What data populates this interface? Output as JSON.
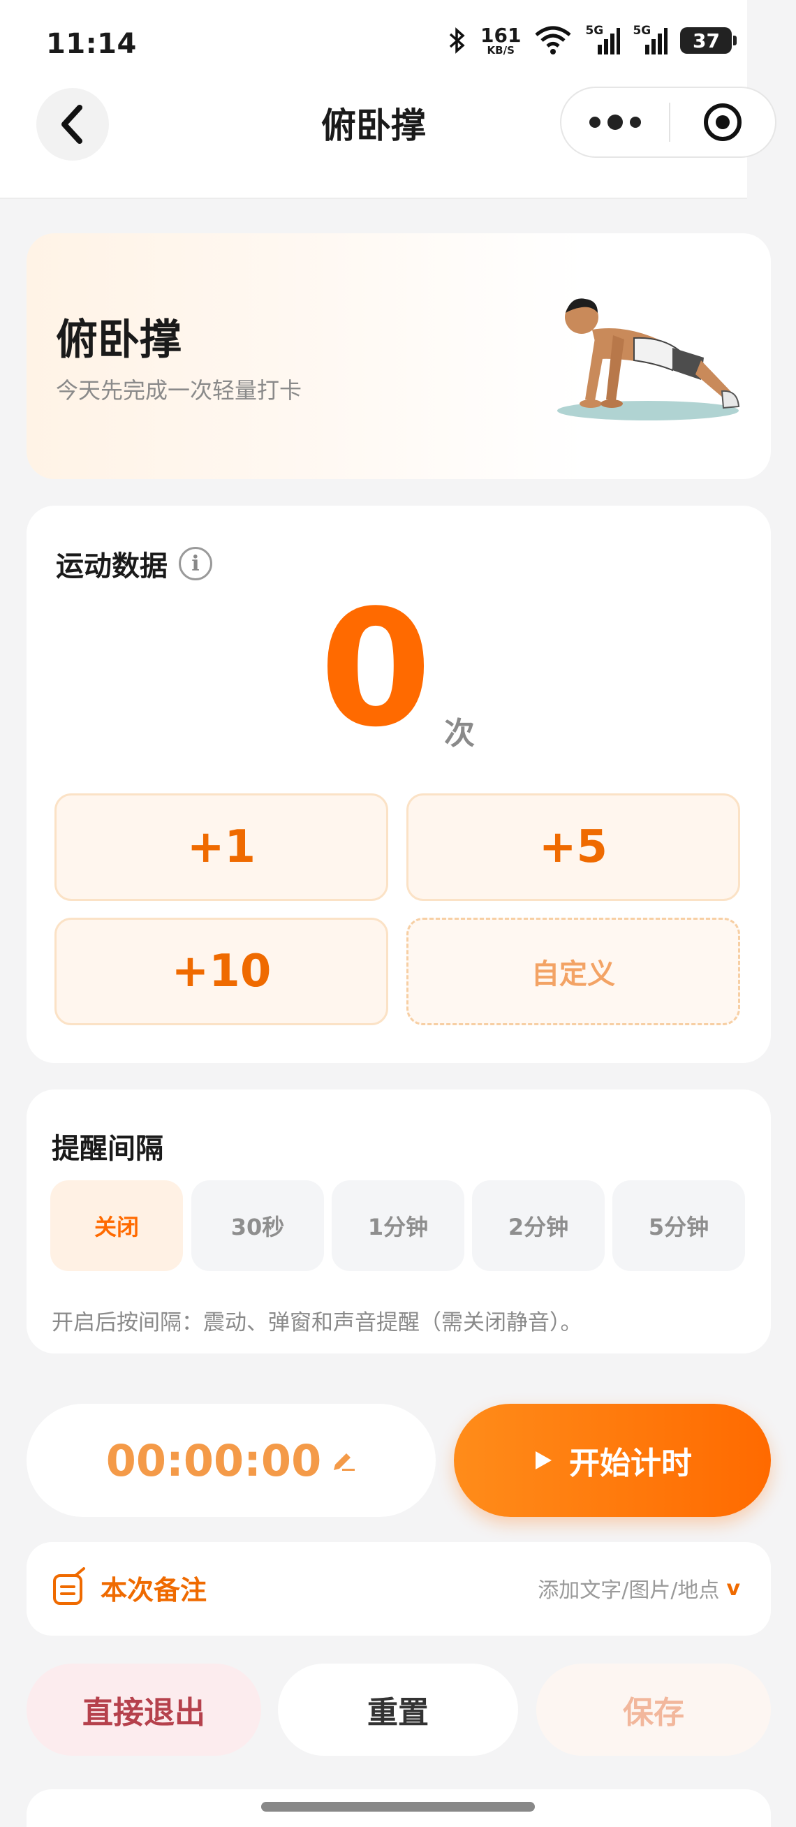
{
  "status_bar": {
    "time": "11:14",
    "net_speed": "161",
    "net_unit": "KB/S",
    "signal1": "5G",
    "signal2": "5G",
    "battery": "37"
  },
  "nav": {
    "title": "俯卧撑"
  },
  "hero": {
    "title": "俯卧撑",
    "subtitle": "今天先完成一次轻量打卡"
  },
  "stats": {
    "title": "运动数据",
    "info_icon": "i",
    "count": "0",
    "unit": "次",
    "buttons": [
      "+1",
      "+5",
      "+10",
      "自定义"
    ]
  },
  "remind": {
    "title": "提醒间隔",
    "options": [
      "关闭",
      "30秒",
      "1分钟",
      "2分钟",
      "5分钟"
    ],
    "selected": "关闭",
    "note": "开启后按间隔：震动、弹窗和声音提醒（需关闭静音）。"
  },
  "timer": {
    "value": "00:00:00",
    "start_label": "开始计时"
  },
  "note_bar": {
    "label": "本次备注",
    "hint": "添加文字/图片/地点",
    "chevron": "v"
  },
  "actions": {
    "exit": "直接退出",
    "reset": "重置",
    "save": "保存"
  },
  "colors": {
    "accent": "#ff6a00",
    "exit_text": "#b5414c",
    "save_text": "#f2b79c"
  }
}
